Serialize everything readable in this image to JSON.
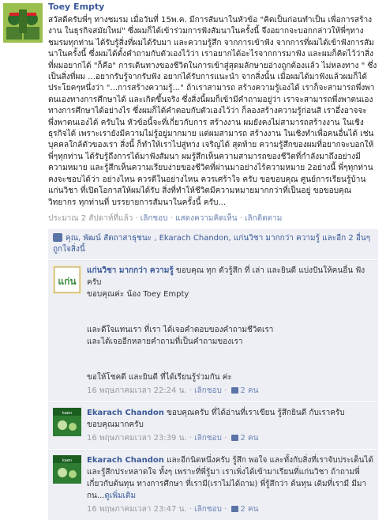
{
  "post": {
    "author": "Toey Empty",
    "text": "สวัสดีครับพี่ๆ ทางชมรม เมื่อวันที่ 15พ.ค. มีการสัมนาในหัวข้อ \"คิดเป็นก่อนทำเป็น เพื่อการสร้างงาน ในธุรกิจสมัยใหม่\" ซึ่งผมก็ได้เข้าร่วมการฟังสัมนาในครั้งนี้ จึงอยากจะบอกกล่าวให้พี่ๆทางชมรมทุกท่าน ได้รับรู้สิ่งที่ผมได้รับมา และความรู้สึก จากการเข้าฟัง จากการที่ผมได้เข้าฟังการสัมนาในครั้งนี้ ซึ่งผมได้ตั้งคำถามกับตัวเองไว้ว่า เราอยากได้อะไรจากการมาฟัง และผมก็คิดไว้ว่าสิ่งที่ผมอยากได้ \"ก็คือ\" การเดินทางของชีวิตในการเข้าสู่สุดมลักษายอ่างถูกต้องแล้ว ไม่หลงทาง \" ซึ่งเป็นสิ่งที่ผม ...อยากรับรู้จากรับฟัง อยากได้รับการแนะนำ จากสิ่งนั้น เมื่อผมได้มาฟังแล้วผมก็ได้ ประโยคๆหนึ่งว่า \"...การสร้างความรู้...\" ถ้าเราสามารถ สร้างความรู้เองได้ เราก็จะสามารถพึ่งพาตนเองทางการศึกษาได้ และเกิดขึ้นจริง ซึ่งสิ่งนี้ผมก็เข้ามีคำถามอยู่ว่า เราจะสามารถพึ่งพาตนเองทางการศึกษาได้อย่างไร ซึ่งผมก็ได้คำตอบกับตัวเองไว้ว่า ก็ลองสร้างความรู้ก่อนสิ เราอึ่งอาจจะพึ่งพาตนเองได้ ครับใน หัวข้อนี้จะที่เกี่ยวกับการ สร้างงาน ผมยังคงไม่สามารถสร้างงาน ในเชิงธุรกิจได้ เพราะเรายังมีความไม่รู้อยู่มากมาย แต่ผมสามารถ สร้างงาน ในเชิงทำเพื่อคนอื่นได้ เช่น บุคคลใกล้ตัวของเรา สิ่งนี้ ก็ทำให้เราไปสู่ทาง เจริญได้ สุดท้าย ความรู้สึกของผมที่อยากจะบอกให้ พี่ๆทุกท่าน ได้รับรู้ถึงการได้มาฟังสัมนา ผมรู้สึกเห็นความสามารถของชีวิตที่กำลังมาถึงอย่างมีความหมาย และรู้สึกเห็นความเรียบง่ายของชีวิตที่ผ่านมาอย่างไร้ความหมาย 2อย่างนี้ พี่ๆทุกท่านคงจะชอบได้ว่า อย่างไหน ควรดีในอย่างไหน ควรเศร้าใจ ครับ ขอขอบคุณ ศูนย์การเรียนรู้บ้านแก่นวิชา ที่เปิดโอกาสให้ผมได้รับ สิ่งที่ทำให้ชีวิตมีความหมายมากกว่าที่เป็นอยู่ ขอขอบคุณ วิทยากร ทุกท่านที่ บรรยายการสัมนาในครั้งนี้ ครับ...",
    "meta_time": "ประมาณ 2 สัปดาห์ที่แล้ว",
    "meta_actions": [
      "เลิกชอบ",
      "แสดงความคิดเห็น",
      "เลิกติดตาม"
    ]
  },
  "likes": {
    "text": "คุณ, พัฒน์ สัตถาสาธุชนะ , Ekarach Chandon, แก่นวิชา มากกว่า ความรู้ และอีก 2 อื่นๆถูกใจสิ่งนี้"
  },
  "comments": [
    {
      "author": "แก่นวิชา มากกว่า ความรู้",
      "text": " ขอบคุณ ทุก ตัวรู้สึก ที่ เล่า และยินดี แบ่งปันให้คนอื่น ฟังครับ\nขอบคุณค่ะ น้อง Toey Empty\n\n\nและดีใจแทนเรา ที่เรา ได้เจอคำตอบของคำถามชีวิตเรา\nและได้เจออีกหลายคำถามที่เป็นคำถามของเรา\n\n\nขอให้โชคดี และยินดี ที่ได้เรียนรู้ร่วมกัน ค่ะ",
      "time": "16 พฤษภาคมเวลา 22:24 น.",
      "unlike": "เลิกชอบ",
      "likes": "2 คน",
      "avatar": "kaenvicha"
    },
    {
      "author": "Ekarach Chandon",
      "text": " ขอบคุณครับ ที่ได้อ่านที่เราเขียน รู้สึกยินดี กับเราครับ ขอบคุณมากครับ",
      "time": "16 พฤษภาคมเวลา 23:39 น.",
      "unlike": "เลิกชอบ",
      "likes": "2 คน",
      "avatar": "ekarach"
    },
    {
      "author": "Ekarach Chandon",
      "text": " และอีกนิดหนึ่งครับ รู้สึก พอใจ และทั้งกับสิ่งที่เราจับประเด็นได้ และรู้สึกประหลาดใจ ทั้งๆ เพราะที่พี่รู้มา เราเพิ่งได้เข้ามาเรียนที่แก่นวิชา ถ้าถามพี่เกี่ยวกับต้นทุน ทางการศึกษา ที่เรามี(เราไม่ได้ถาม) พี่รู้สึกว่า ต้นทุน เดิมที่เรามี มีมากน...",
      "see_more": "ดูเพิ่มเติม",
      "time": "16 พฤษภาคมเวลา 23:47 น.",
      "unlike": "เลิกชอบ",
      "likes": "2 คน",
      "avatar": "ekarach"
    }
  ]
}
